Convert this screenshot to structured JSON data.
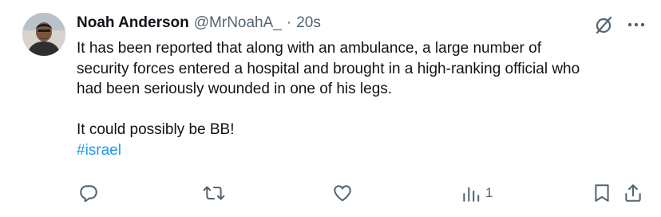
{
  "tweet": {
    "author": {
      "name": "Noah Anderson",
      "handle": "@MrNoahA_",
      "separator": "·",
      "time": "20s"
    },
    "body": {
      "line1": "It has been reported that along with an ambulance, a large number of",
      "line2": "security forces entered a hospital and brought in a high-ranking official who",
      "line3": "had been seriously wounded in one of his legs.",
      "line4": "It could possibly be BB!",
      "hashtag": "#israel"
    },
    "actions": {
      "reply_icon": "reply-icon",
      "retweet_icon": "retweet-icon",
      "like_icon": "heart-icon",
      "views_icon": "views-icon",
      "views_count": "1",
      "bookmark_icon": "bookmark-icon",
      "share_icon": "share-icon"
    },
    "icons": {
      "grok": "grok-icon",
      "more": "more-icon"
    }
  },
  "colors": {
    "text": "#0f1419",
    "muted": "#536471",
    "link": "#1d9bf0",
    "background": "#ffffff"
  }
}
